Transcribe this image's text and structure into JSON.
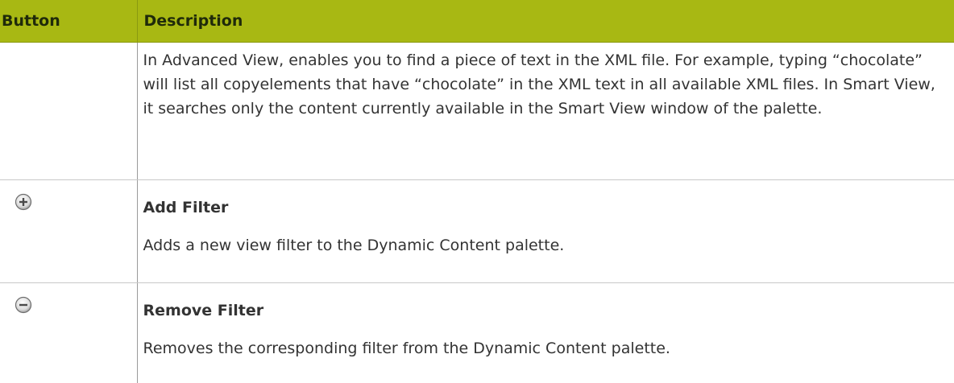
{
  "table": {
    "headers": {
      "button": "Button",
      "description": "Description"
    },
    "rows": [
      {
        "icon": "",
        "title": "",
        "text": "In Advanced View, enables you to find a piece of text in the XML file. For example, typing “chocolate” will list all copyelements that have “chocolate” in the XML text in all available XML files. In Smart View, it searches only the content currently available in the Smart View window of the palette."
      },
      {
        "icon": "plus-circle-icon",
        "title": "Add Filter",
        "text": "Adds a new view filter to the Dynamic Content palette."
      },
      {
        "icon": "minus-circle-icon",
        "title": "Remove Filter",
        "text": "Removes the corresponding filter from the Dynamic Content palette."
      }
    ]
  },
  "colors": {
    "header_background": "#a8b813",
    "border": "#9a9a9a",
    "text": "#333333"
  }
}
